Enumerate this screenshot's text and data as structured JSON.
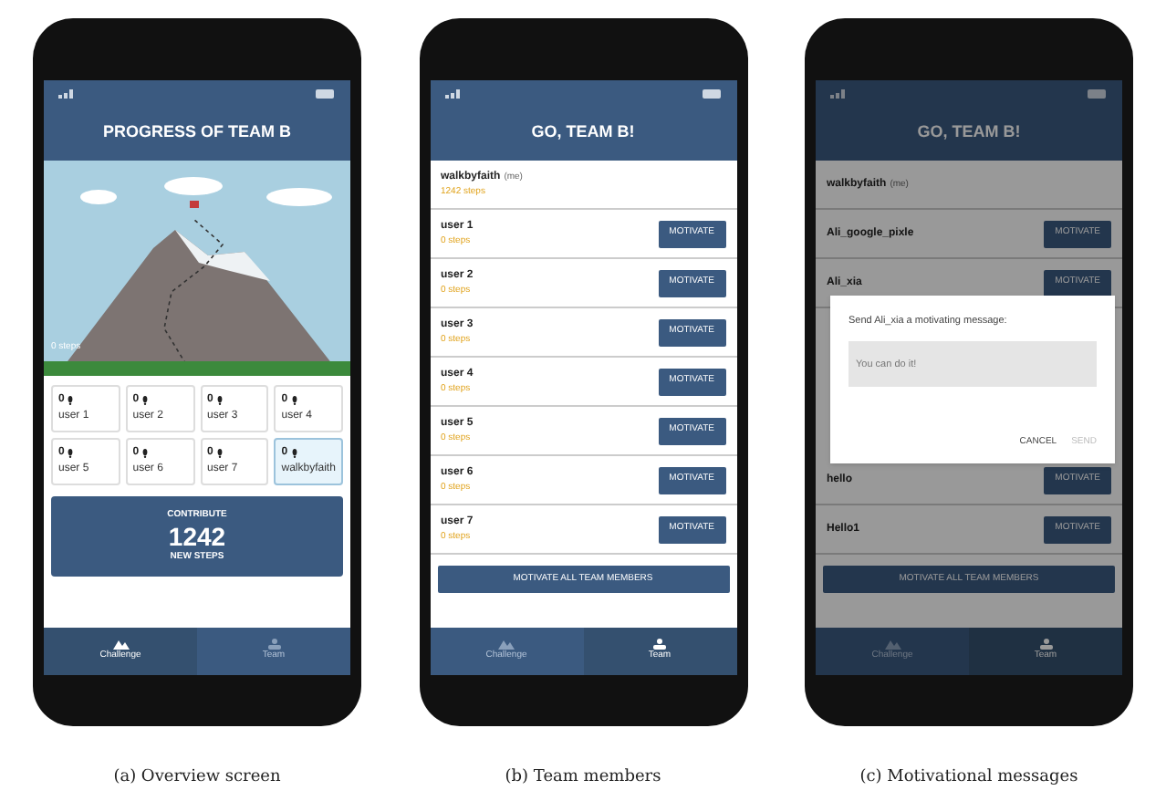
{
  "panels": [
    {
      "kind": "overview",
      "title": "PROGRESS OF TEAM B",
      "summit_label": "0 steps",
      "members": [
        {
          "steps": "0",
          "name": "user 1",
          "selected": false
        },
        {
          "steps": "0",
          "name": "user 2",
          "selected": false
        },
        {
          "steps": "0",
          "name": "user 3",
          "selected": false
        },
        {
          "steps": "0",
          "name": "user 4",
          "selected": false
        },
        {
          "steps": "0",
          "name": "user 5",
          "selected": false
        },
        {
          "steps": "0",
          "name": "user 6",
          "selected": false
        },
        {
          "steps": "0",
          "name": "user 7",
          "selected": false
        },
        {
          "steps": "0",
          "name": "walkbyfaith",
          "selected": true
        }
      ],
      "contribute": {
        "label": "CONTRIBUTE",
        "value": "1242",
        "unit": "NEW STEPS"
      },
      "tabs": [
        {
          "label": "Challenge",
          "selected": true
        },
        {
          "label": "Team",
          "selected": false
        }
      ],
      "caption": "(a) Overview screen"
    },
    {
      "kind": "team",
      "title": "GO, TEAM B!",
      "me": {
        "name": "walkbyfaith",
        "suffix": "(me)",
        "steps": "1242 steps"
      },
      "members": [
        {
          "name": "user 1",
          "steps": "0 steps",
          "action": "MOTIVATE"
        },
        {
          "name": "user 2",
          "steps": "0 steps",
          "action": "MOTIVATE"
        },
        {
          "name": "user 3",
          "steps": "0 steps",
          "action": "MOTIVATE"
        },
        {
          "name": "user 4",
          "steps": "0 steps",
          "action": "MOTIVATE"
        },
        {
          "name": "user 5",
          "steps": "0 steps",
          "action": "MOTIVATE"
        },
        {
          "name": "user 6",
          "steps": "0 steps",
          "action": "MOTIVATE"
        },
        {
          "name": "user 7",
          "steps": "0 steps",
          "action": "MOTIVATE"
        }
      ],
      "motivate_all": "MOTIVATE ALL TEAM MEMBERS",
      "tabs": [
        {
          "label": "Challenge",
          "selected": false
        },
        {
          "label": "Team",
          "selected": true
        }
      ],
      "caption": "(b) Team members"
    },
    {
      "kind": "message",
      "title": "GO, TEAM B!",
      "me": {
        "name": "walkbyfaith",
        "suffix": "(me)"
      },
      "members_above": [
        {
          "name": "Ali_google_pixle",
          "action": "MOTIVATE"
        },
        {
          "name": "Ali_xia",
          "action": "MOTIVATE"
        }
      ],
      "members_below": [
        {
          "name": "hello",
          "action": "MOTIVATE"
        },
        {
          "name": "Hello1",
          "action": "MOTIVATE"
        }
      ],
      "motivate_all": "MOTIVATE ALL TEAM MEMBERS",
      "dialog": {
        "prompt": "Send Ali_xia a motivating message:",
        "value": "You can do it!",
        "buttons": [
          {
            "label": "CANCEL",
            "disabled": false
          },
          {
            "label": "SEND",
            "disabled": true
          }
        ]
      },
      "tabs": [
        {
          "label": "Challenge",
          "selected": false
        },
        {
          "label": "Team",
          "selected": true
        }
      ],
      "caption": "(c) Motivational messages"
    }
  ]
}
